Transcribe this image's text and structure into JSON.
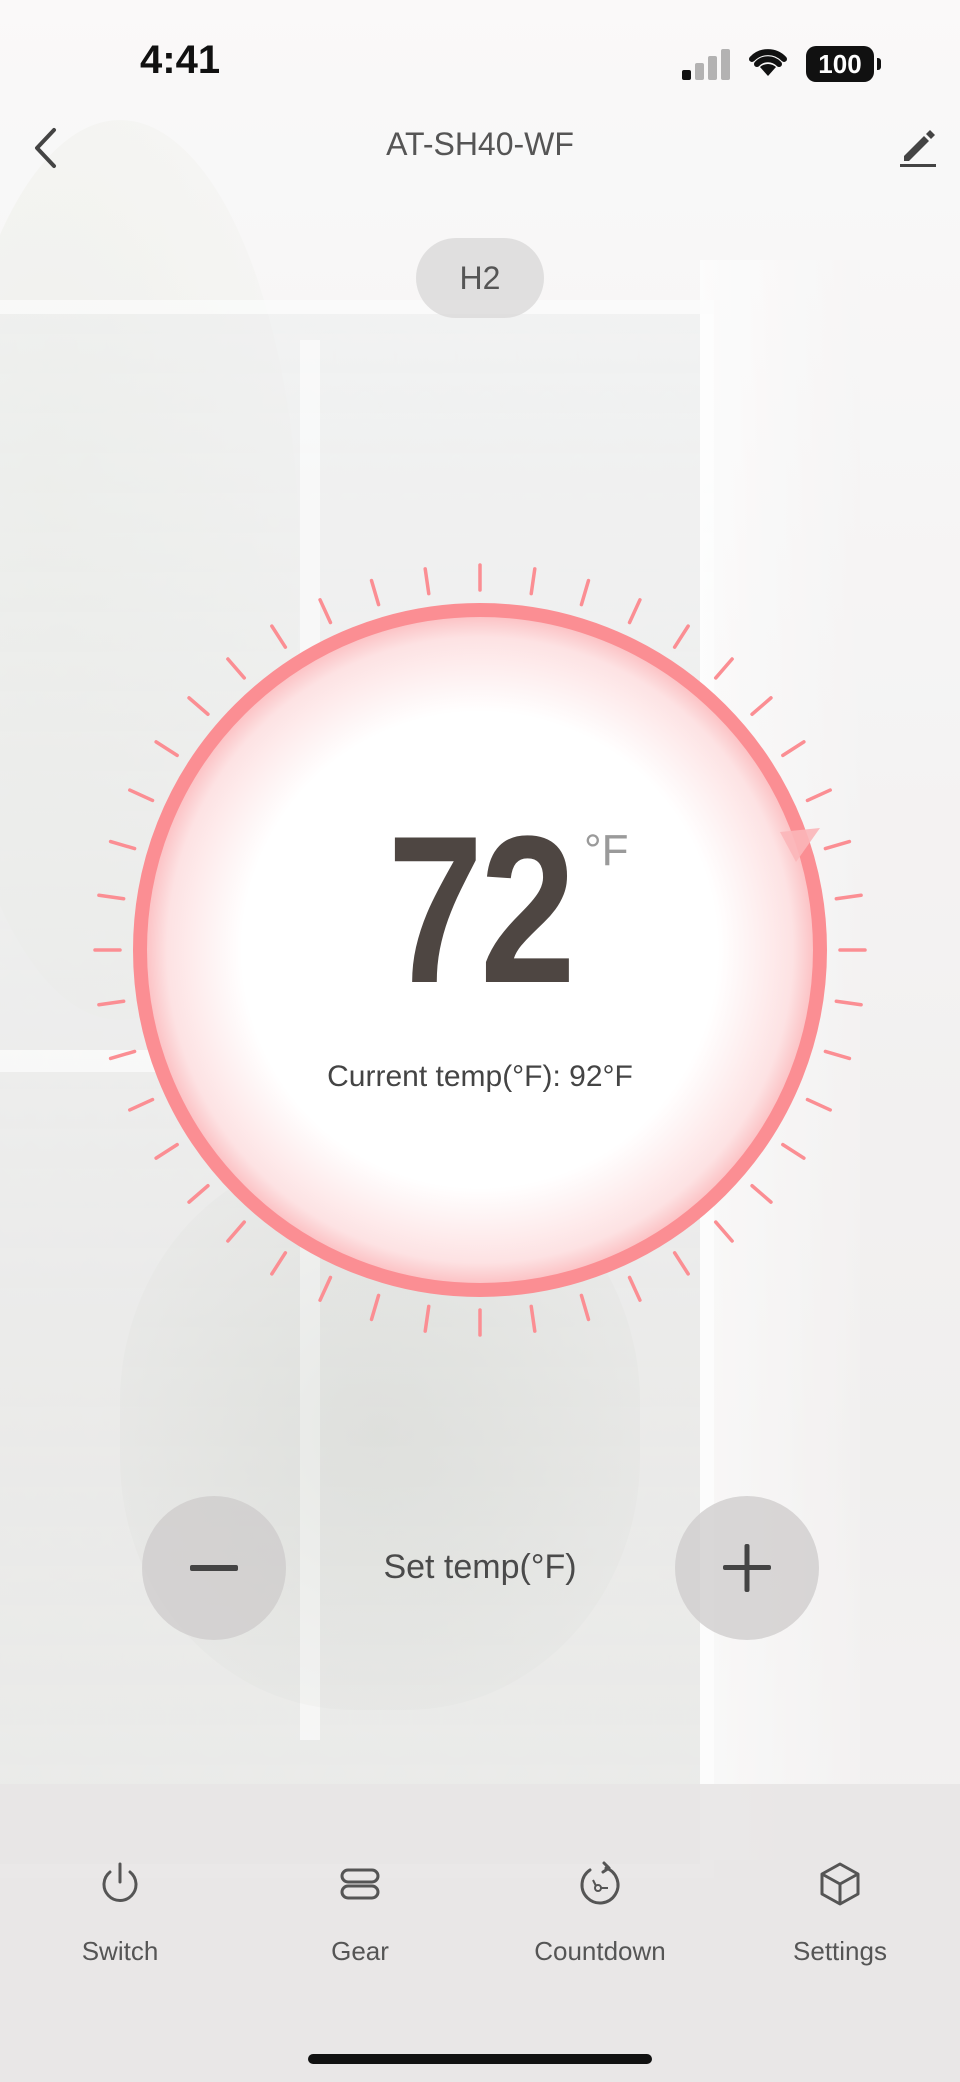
{
  "status_bar": {
    "time": "4:41",
    "battery": "100"
  },
  "header": {
    "title": "AT-SH40-WF"
  },
  "gear_chip": "H2",
  "dial": {
    "set_temp": "72",
    "unit": "°F",
    "current_temp_text": "Current temp(°F): 92°F",
    "ring_color": "#fb8e93"
  },
  "controls": {
    "label": "Set temp(°F)"
  },
  "nav": {
    "items": [
      {
        "label": "Switch",
        "icon": "power-icon"
      },
      {
        "label": "Gear",
        "icon": "gear-levels-icon"
      },
      {
        "label": "Countdown",
        "icon": "countdown-icon"
      },
      {
        "label": "Settings",
        "icon": "cube-icon"
      }
    ]
  }
}
